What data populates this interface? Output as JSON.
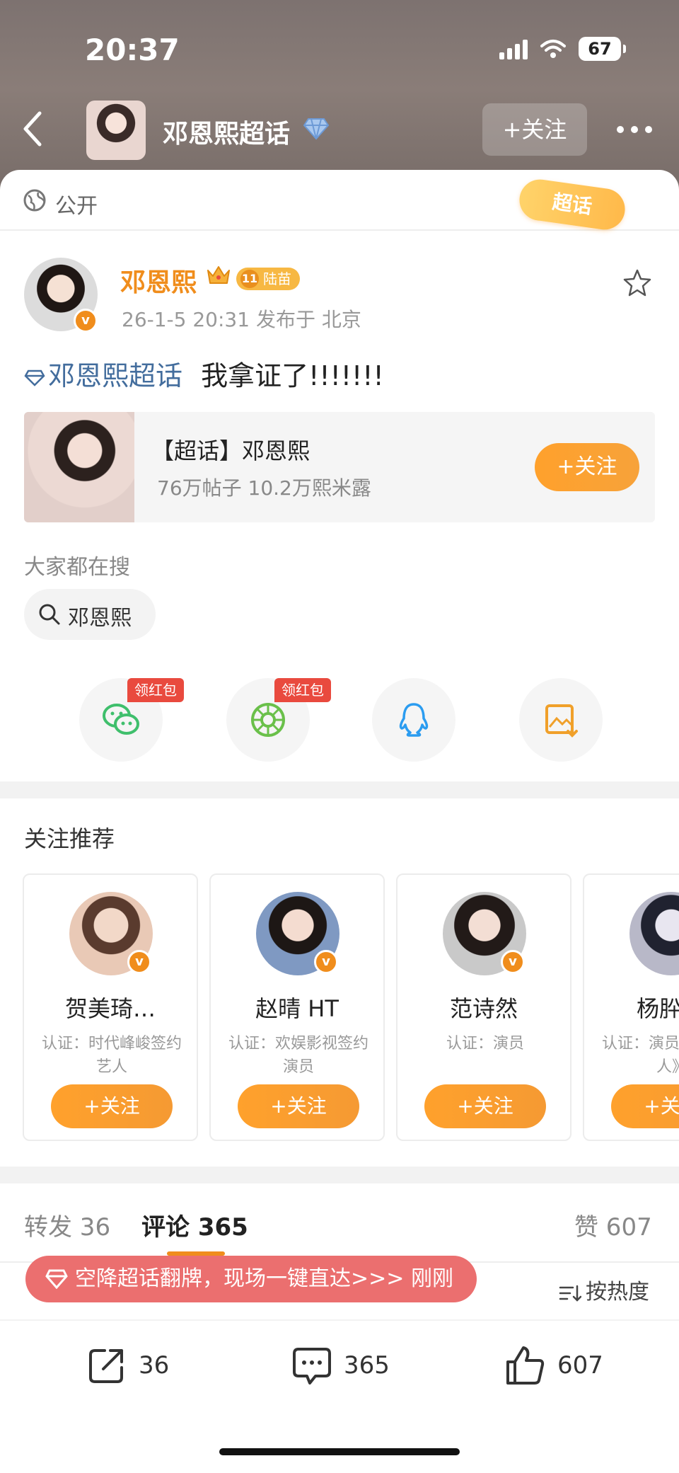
{
  "status_bar": {
    "time": "20:37",
    "battery": "67"
  },
  "header": {
    "title": "邓恩熙超话",
    "follow_label": "+关注"
  },
  "visibility": {
    "label": "公开",
    "badge": "超话"
  },
  "post": {
    "author": "邓恩熙",
    "level_badge": "陆苗",
    "level_num": "11",
    "meta": "26-1-5 20:31  发布于 北京",
    "topic_tag": "邓恩熙超话",
    "text": "我拿证了!!!!!!!"
  },
  "topic_card": {
    "name": "【超话】邓恩熙",
    "stats": "76万帖子 10.2万熙米露",
    "follow_label": "+关注"
  },
  "search": {
    "label": "大家都在搜",
    "chip": "邓恩熙"
  },
  "share": {
    "red_packet_label": "领红包"
  },
  "recommend": {
    "title": "关注推荐",
    "follow_label": "+关注",
    "cards": [
      {
        "name": "贺美琦…",
        "desc": "认证：时代峰峻签约艺人"
      },
      {
        "name": "赵晴 HT",
        "desc": "认证：欢娱影视签约演员"
      },
      {
        "name": "范诗然",
        "desc": "认证：演员"
      },
      {
        "name": "杨肸子",
        "desc": "认证：演员《树下有人》"
      }
    ]
  },
  "tabs": {
    "repost": "转发 36",
    "comment": "评论 365",
    "like": "赞 607"
  },
  "sort_label": "按热度",
  "toast": "空降超话翻牌，现场一键直达>>> 刚刚",
  "bottom_bar": {
    "repost": "36",
    "comment": "365",
    "like": "607"
  },
  "colors": {
    "accent": "#f08d1c",
    "topic_link": "#436d9d",
    "toast": "#eb6f6f",
    "red_packet": "#e94a3e"
  }
}
